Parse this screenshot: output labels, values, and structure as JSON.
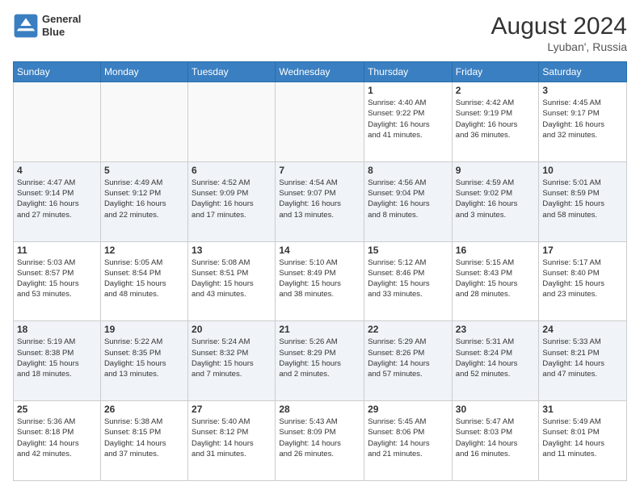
{
  "header": {
    "logo_line1": "General",
    "logo_line2": "Blue",
    "month_year": "August 2024",
    "location": "Lyuban', Russia"
  },
  "weekdays": [
    "Sunday",
    "Monday",
    "Tuesday",
    "Wednesday",
    "Thursday",
    "Friday",
    "Saturday"
  ],
  "weeks": [
    [
      {
        "day": "",
        "info": ""
      },
      {
        "day": "",
        "info": ""
      },
      {
        "day": "",
        "info": ""
      },
      {
        "day": "",
        "info": ""
      },
      {
        "day": "1",
        "info": "Sunrise: 4:40 AM\nSunset: 9:22 PM\nDaylight: 16 hours\nand 41 minutes."
      },
      {
        "day": "2",
        "info": "Sunrise: 4:42 AM\nSunset: 9:19 PM\nDaylight: 16 hours\nand 36 minutes."
      },
      {
        "day": "3",
        "info": "Sunrise: 4:45 AM\nSunset: 9:17 PM\nDaylight: 16 hours\nand 32 minutes."
      }
    ],
    [
      {
        "day": "4",
        "info": "Sunrise: 4:47 AM\nSunset: 9:14 PM\nDaylight: 16 hours\nand 27 minutes."
      },
      {
        "day": "5",
        "info": "Sunrise: 4:49 AM\nSunset: 9:12 PM\nDaylight: 16 hours\nand 22 minutes."
      },
      {
        "day": "6",
        "info": "Sunrise: 4:52 AM\nSunset: 9:09 PM\nDaylight: 16 hours\nand 17 minutes."
      },
      {
        "day": "7",
        "info": "Sunrise: 4:54 AM\nSunset: 9:07 PM\nDaylight: 16 hours\nand 13 minutes."
      },
      {
        "day": "8",
        "info": "Sunrise: 4:56 AM\nSunset: 9:04 PM\nDaylight: 16 hours\nand 8 minutes."
      },
      {
        "day": "9",
        "info": "Sunrise: 4:59 AM\nSunset: 9:02 PM\nDaylight: 16 hours\nand 3 minutes."
      },
      {
        "day": "10",
        "info": "Sunrise: 5:01 AM\nSunset: 8:59 PM\nDaylight: 15 hours\nand 58 minutes."
      }
    ],
    [
      {
        "day": "11",
        "info": "Sunrise: 5:03 AM\nSunset: 8:57 PM\nDaylight: 15 hours\nand 53 minutes."
      },
      {
        "day": "12",
        "info": "Sunrise: 5:05 AM\nSunset: 8:54 PM\nDaylight: 15 hours\nand 48 minutes."
      },
      {
        "day": "13",
        "info": "Sunrise: 5:08 AM\nSunset: 8:51 PM\nDaylight: 15 hours\nand 43 minutes."
      },
      {
        "day": "14",
        "info": "Sunrise: 5:10 AM\nSunset: 8:49 PM\nDaylight: 15 hours\nand 38 minutes."
      },
      {
        "day": "15",
        "info": "Sunrise: 5:12 AM\nSunset: 8:46 PM\nDaylight: 15 hours\nand 33 minutes."
      },
      {
        "day": "16",
        "info": "Sunrise: 5:15 AM\nSunset: 8:43 PM\nDaylight: 15 hours\nand 28 minutes."
      },
      {
        "day": "17",
        "info": "Sunrise: 5:17 AM\nSunset: 8:40 PM\nDaylight: 15 hours\nand 23 minutes."
      }
    ],
    [
      {
        "day": "18",
        "info": "Sunrise: 5:19 AM\nSunset: 8:38 PM\nDaylight: 15 hours\nand 18 minutes."
      },
      {
        "day": "19",
        "info": "Sunrise: 5:22 AM\nSunset: 8:35 PM\nDaylight: 15 hours\nand 13 minutes."
      },
      {
        "day": "20",
        "info": "Sunrise: 5:24 AM\nSunset: 8:32 PM\nDaylight: 15 hours\nand 7 minutes."
      },
      {
        "day": "21",
        "info": "Sunrise: 5:26 AM\nSunset: 8:29 PM\nDaylight: 15 hours\nand 2 minutes."
      },
      {
        "day": "22",
        "info": "Sunrise: 5:29 AM\nSunset: 8:26 PM\nDaylight: 14 hours\nand 57 minutes."
      },
      {
        "day": "23",
        "info": "Sunrise: 5:31 AM\nSunset: 8:24 PM\nDaylight: 14 hours\nand 52 minutes."
      },
      {
        "day": "24",
        "info": "Sunrise: 5:33 AM\nSunset: 8:21 PM\nDaylight: 14 hours\nand 47 minutes."
      }
    ],
    [
      {
        "day": "25",
        "info": "Sunrise: 5:36 AM\nSunset: 8:18 PM\nDaylight: 14 hours\nand 42 minutes."
      },
      {
        "day": "26",
        "info": "Sunrise: 5:38 AM\nSunset: 8:15 PM\nDaylight: 14 hours\nand 37 minutes."
      },
      {
        "day": "27",
        "info": "Sunrise: 5:40 AM\nSunset: 8:12 PM\nDaylight: 14 hours\nand 31 minutes."
      },
      {
        "day": "28",
        "info": "Sunrise: 5:43 AM\nSunset: 8:09 PM\nDaylight: 14 hours\nand 26 minutes."
      },
      {
        "day": "29",
        "info": "Sunrise: 5:45 AM\nSunset: 8:06 PM\nDaylight: 14 hours\nand 21 minutes."
      },
      {
        "day": "30",
        "info": "Sunrise: 5:47 AM\nSunset: 8:03 PM\nDaylight: 14 hours\nand 16 minutes."
      },
      {
        "day": "31",
        "info": "Sunrise: 5:49 AM\nSunset: 8:01 PM\nDaylight: 14 hours\nand 11 minutes."
      }
    ]
  ]
}
